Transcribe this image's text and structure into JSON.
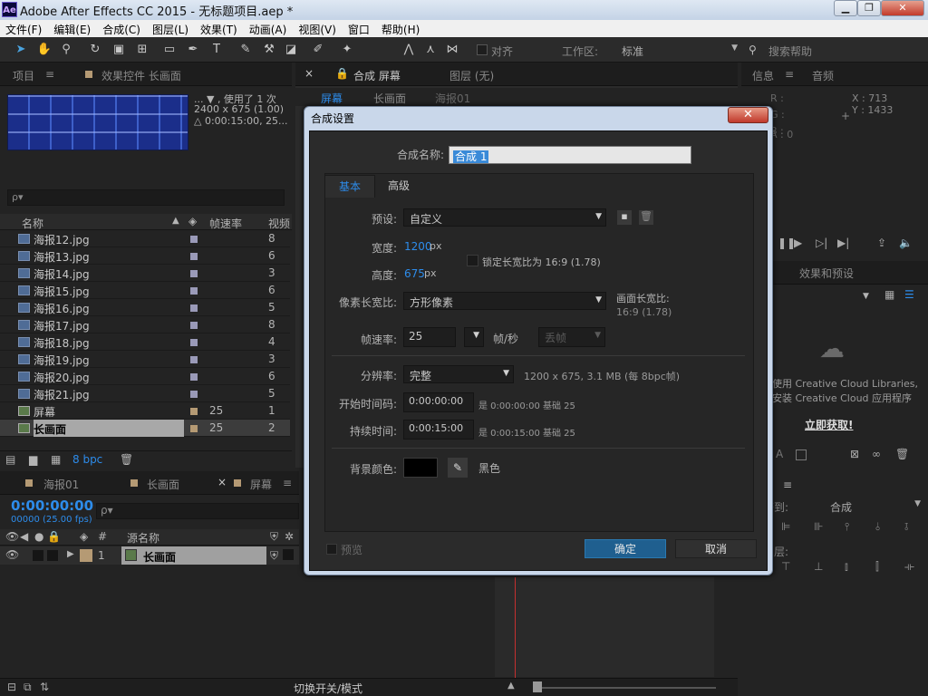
{
  "window": {
    "title": "Adobe After Effects CC 2015 - 无标题项目.aep *",
    "logo": "Ae",
    "buttons": {
      "minimize": "▁",
      "maximize": "❐",
      "close": "✕"
    }
  },
  "menu": [
    "文件(F)",
    "编辑(E)",
    "合成(C)",
    "图层(L)",
    "效果(T)",
    "动画(A)",
    "视图(V)",
    "窗口",
    "帮助(H)"
  ],
  "toolbar": {
    "snap_label": "对齐",
    "workspace_label": "工作区:",
    "workspace_value": "标准",
    "search_placeholder": "搜索帮助"
  },
  "project_panel": {
    "tab_project": "项目",
    "tab_effects": "效果控件 长画面",
    "info_line1": "... ▼ , 使用了 1 次",
    "info_line2": "2400 x 675 (1.00)",
    "info_line3": "△ 0:00:15:00, 25...",
    "search_placeholder": "ρ▾",
    "col_name": "名称",
    "col_fps": "帧速率",
    "col_video": "视频",
    "items": [
      {
        "name": "海报12.jpg",
        "fps": "",
        "v": "8",
        "type": "img"
      },
      {
        "name": "海报13.jpg",
        "fps": "",
        "v": "6",
        "type": "img"
      },
      {
        "name": "海报14.jpg",
        "fps": "",
        "v": "3",
        "type": "img"
      },
      {
        "name": "海报15.jpg",
        "fps": "",
        "v": "6",
        "type": "img"
      },
      {
        "name": "海报16.jpg",
        "fps": "",
        "v": "5",
        "type": "img"
      },
      {
        "name": "海报17.jpg",
        "fps": "",
        "v": "8",
        "type": "img"
      },
      {
        "name": "海报18.jpg",
        "fps": "",
        "v": "4",
        "type": "img"
      },
      {
        "name": "海报19.jpg",
        "fps": "",
        "v": "3",
        "type": "img"
      },
      {
        "name": "海报20.jpg",
        "fps": "",
        "v": "6",
        "type": "img"
      },
      {
        "name": "海报21.jpg",
        "fps": "",
        "v": "5",
        "type": "img"
      },
      {
        "name": "屏幕",
        "fps": "25",
        "v": "1",
        "type": "comp"
      },
      {
        "name": "长画面",
        "fps": "25",
        "v": "2",
        "type": "comp"
      }
    ],
    "bpc": "8 bpc"
  },
  "comp_panel": {
    "tab_comp": "合成 屏幕",
    "tab_layer": "图层 (无)",
    "breadcrumbs": [
      "屏幕",
      "长画面",
      "海报01"
    ]
  },
  "info_panel": {
    "tab_info": "信息",
    "tab_audio": "音频",
    "r": "R :",
    "g": "G :",
    "b": "B :",
    "a": "A : 0",
    "x": "X : 713",
    "y": "Y : 1433"
  },
  "effects_panel": {
    "tab": "效果和预设",
    "cc_line1": "使用 Creative Cloud Libraries,",
    "cc_line2": "安装 Creative Cloud 应用程序",
    "cc_link": "立即获取!"
  },
  "align_panel": {
    "align_to_label": "对齐到:",
    "align_to_value": "合成",
    "distribute": "分布图层:"
  },
  "timeline": {
    "tabs": [
      "海报01",
      "长画面",
      "屏幕"
    ],
    "timecode": "0:00:00:00",
    "frames": "00000 (25.00 fps)",
    "col_source": "源名称",
    "col_num": "#",
    "layer_index": "1",
    "layer_name": "长画面",
    "toggle_label": "切换开关/模式"
  },
  "dialog": {
    "title": "合成设置",
    "close": "✕",
    "comp_name_label": "合成名称:",
    "comp_name_value": "合成 1",
    "tab_basic": "基本",
    "tab_advanced": "高级",
    "preset_label": "预设:",
    "preset_value": "自定义",
    "width_label": "宽度:",
    "width_value": "1200",
    "height_label": "高度:",
    "height_value": "675",
    "px": "px",
    "lock_label": "锁定长宽比为 16:9 (1.78)",
    "par_label": "像素长宽比:",
    "par_value": "方形像素",
    "frame_aspect_label": "画面长宽比:",
    "frame_aspect_value": "16:9 (1.78)",
    "fps_label": "帧速率:",
    "fps_value": "25",
    "fps_unit": "帧/秒",
    "drop_frame": "丢帧",
    "res_label": "分辨率:",
    "res_value": "完整",
    "res_info": "1200 x 675, 3.1 MB (每 8bpc帧)",
    "start_label": "开始时间码:",
    "start_value": "0:00:00:00",
    "start_info": "是 0:00:00:00  基础 25",
    "dur_label": "持续时间:",
    "dur_value": "0:00:15:00",
    "dur_info": "是 0:00:15:00  基础 25",
    "bg_label": "背景颜色:",
    "bg_name": "黑色",
    "bg_color": "#000000",
    "preview": "预览",
    "ok": "确定",
    "cancel": "取消"
  },
  "colors": {
    "accent": "#2d8ceb",
    "ok_button": "#1f5f8f"
  }
}
